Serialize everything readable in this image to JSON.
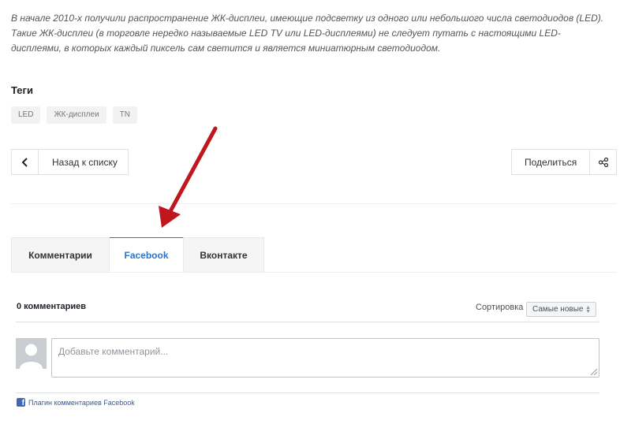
{
  "article": {
    "intro": "В начале 2010-х получили распространение ЖК-дисплеи, имеющие подсветку из одного или небольшого числа светодиодов (LED). Такие ЖК-дисплеи (в торговле нередко называемые LED TV или LED-дисплеями) не следует путать с настоящими LED-дисплеями, в которых каждый пиксель сам светится и является миниатюрным светодиодом."
  },
  "tags": {
    "title": "Теги",
    "items": [
      "LED",
      "ЖК-дисплеи",
      "TN"
    ]
  },
  "nav": {
    "back_label": "Назад к списку",
    "share_label": "Поделиться",
    "back_icon": "chevron-left-icon",
    "share_icon": "share-icon"
  },
  "comment_tabs": [
    {
      "label": "Комментарии",
      "active": false
    },
    {
      "label": "Facebook",
      "active": true
    },
    {
      "label": "Вконтакте",
      "active": false
    }
  ],
  "facebook": {
    "count_label": "0 комментариев",
    "sort_label": "Сортировка",
    "sort_selected": "Самые новые",
    "placeholder": "Добавьте комментарий...",
    "plugin_label": "Плагин комментариев Facebook",
    "brand_color": "#4267b2"
  },
  "colors": {
    "active_tab": "#2d74c4",
    "annotation_arrow": "#c0161d"
  }
}
